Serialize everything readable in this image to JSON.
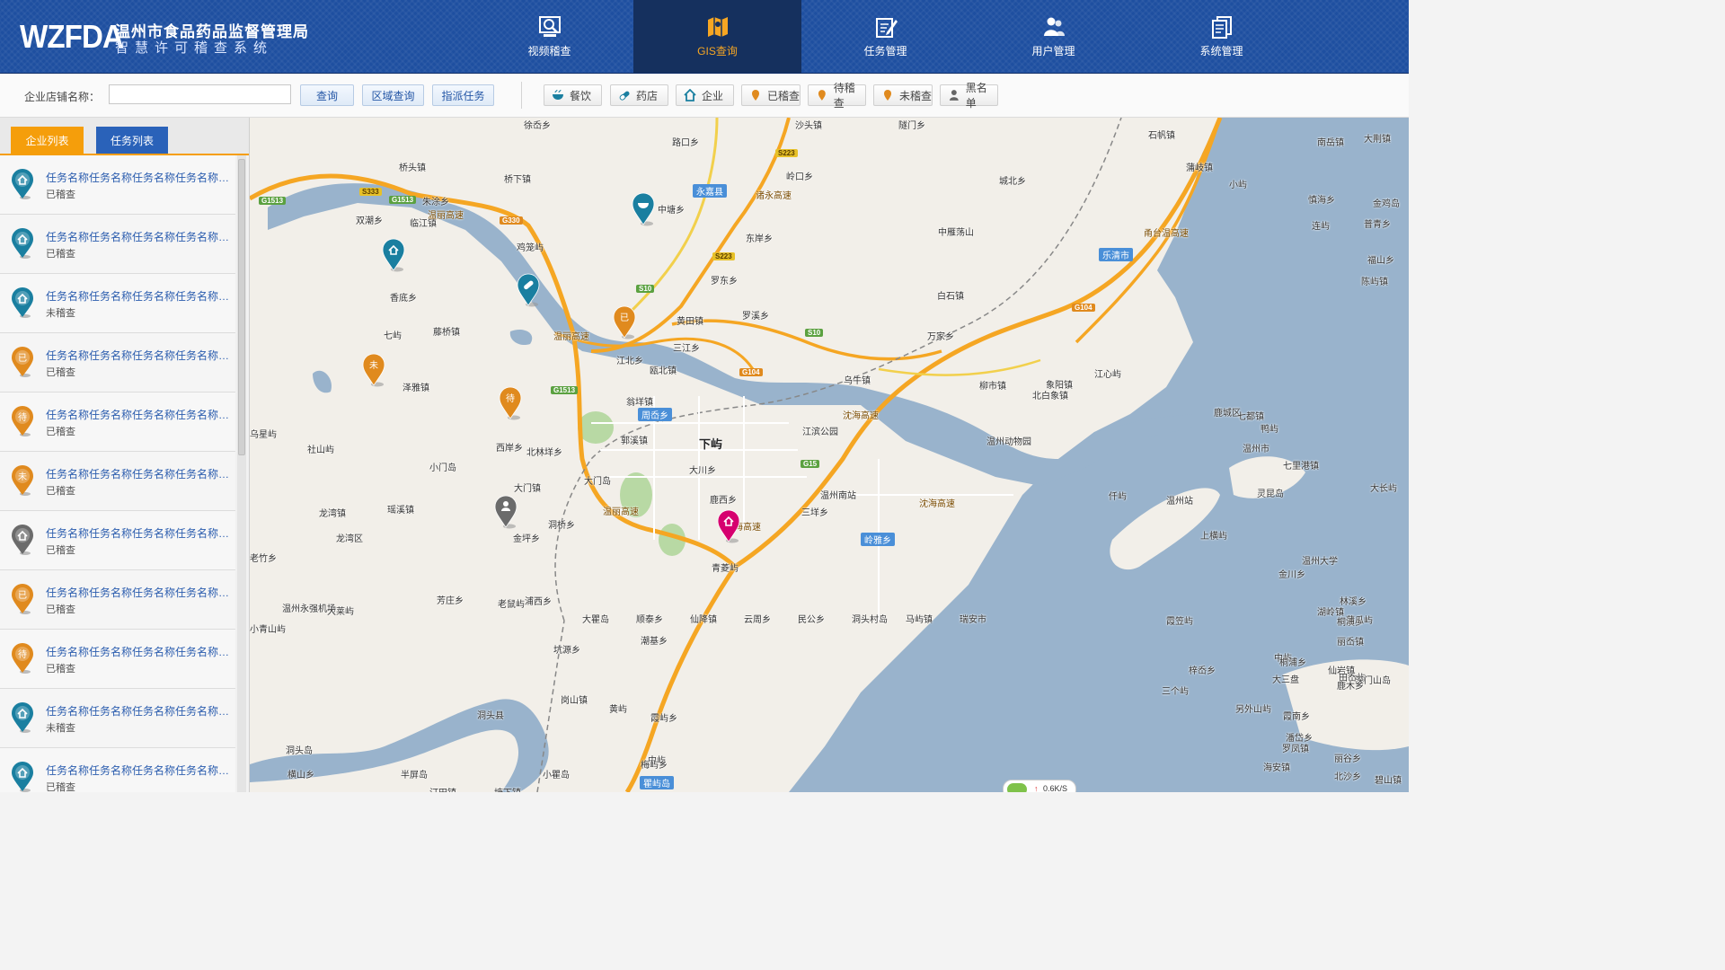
{
  "header": {
    "logo": "WZFDA",
    "title": "温州市食品药品监督管理局",
    "subtitle": "智慧许可稽查系统",
    "nav": [
      {
        "label": "视频稽查",
        "icon": "video-inspect-icon",
        "active": false
      },
      {
        "label": "GIS查询",
        "icon": "gis-map-icon",
        "active": true
      },
      {
        "label": "任务管理",
        "icon": "task-edit-icon",
        "active": false
      },
      {
        "label": "用户管理",
        "icon": "users-icon",
        "active": false
      },
      {
        "label": "系统管理",
        "icon": "documents-icon",
        "active": false
      }
    ]
  },
  "toolbar": {
    "search_label": "企业店铺名称：",
    "search_value": "",
    "query_button": "查询",
    "area_query_button": "区域查询",
    "assign_task_button": "指派任务",
    "filters": [
      {
        "label": "餐饮",
        "icon": "bowl-icon"
      },
      {
        "label": "药店",
        "icon": "pill-icon"
      },
      {
        "label": "企业",
        "icon": "home-icon"
      },
      {
        "label": "已稽查",
        "icon": "pin-orange-icon"
      },
      {
        "label": "待稽查",
        "icon": "pin-orange-icon"
      },
      {
        "label": "未稽查",
        "icon": "pin-orange-icon"
      },
      {
        "label": "黑名单",
        "icon": "person-icon"
      }
    ]
  },
  "panel": {
    "tabs": [
      "企业列表",
      "任务列表"
    ],
    "active_tab": 0,
    "items": [
      {
        "title": "任务名称任务名称任务名称任务名称任务名称",
        "status": "已稽查",
        "pin": "food",
        "color": "#1a7fa0"
      },
      {
        "title": "任务名称任务名称任务名称任务名称任务名称",
        "status": "已稽查",
        "pin": "pharmacy",
        "color": "#1a7fa0"
      },
      {
        "title": "任务名称任务名称任务名称任务名称任务名称",
        "status": "未稽查",
        "pin": "enterprise",
        "color": "#1a7fa0"
      },
      {
        "title": "任务名称任务名称任务名称任务名称任务名称",
        "status": "已稽查",
        "pin": "已",
        "color": "#e08a1e"
      },
      {
        "title": "任务名称任务名称任务名称任务名称任务名称",
        "status": "已稽查",
        "pin": "待",
        "color": "#e08a1e"
      },
      {
        "title": "任务名称任务名称任务名称任务名称任务名称",
        "status": "已稽查",
        "pin": "未",
        "color": "#e08a1e"
      },
      {
        "title": "任务名称任务名称任务名称任务名称任务名称",
        "status": "已稽查",
        "pin": "blacklist",
        "color": "#6b6b6b"
      },
      {
        "title": "任务名称任务名称任务名称任务名称任务名称",
        "status": "已稽查",
        "pin": "已",
        "color": "#e08a1e"
      },
      {
        "title": "任务名称任务名称任务名称任务名称任务名称",
        "status": "已稽查",
        "pin": "待",
        "color": "#e08a1e"
      },
      {
        "title": "任务名称任务名称任务名称任务名称任务名称",
        "status": "未稽查",
        "pin": "enterprise",
        "color": "#1a7fa0"
      },
      {
        "title": "任务名称任务名称任务名称任务名称任务名称",
        "status": "已稽查",
        "pin": "food",
        "color": "#1a7fa0"
      }
    ]
  },
  "map": {
    "labels": [
      "徐岙乡",
      "路口乡",
      "沙头镇",
      "隧门乡",
      "石帆镇",
      "南岳镇",
      "大荆镇",
      "桥头镇",
      "桥下镇",
      "岭口乡",
      "永嘉县",
      "中塘乡",
      "城北乡",
      "蒲岐镇",
      "小屿",
      "慎海乡",
      "金鸡岛",
      "双潮乡",
      "临江镇",
      "朱涂乡",
      "鸡笼屿",
      "东岸乡",
      "中雁荡山",
      "乐清市",
      "连屿",
      "普青乡",
      "福山乡",
      "陈屿镇",
      "香底乡",
      "罗东乡",
      "白石镇",
      "七屿",
      "藤桥镇",
      "黄田镇",
      "罗溪乡",
      "万家乡",
      "江北乡",
      "三江乡",
      "瓯北镇",
      "乌牛镇",
      "柳市镇",
      "象阳镇",
      "泽雅镇",
      "江心屿",
      "北白象镇",
      "翁垟镇",
      "周岙乡",
      "江滨公园",
      "鹿城区",
      "七都镇",
      "鸭屿",
      "乌星屿",
      "社山屿",
      "北林垟乡",
      "西岸乡",
      "郭溪镇",
      "下屿",
      "温州动物园",
      "温州市",
      "七里港镇",
      "小门岛",
      "大门岛",
      "大川乡",
      "仟屿",
      "温州站",
      "灵昆岛",
      "大长屿",
      "大门镇",
      "鹿西乡",
      "温州南站",
      "三垟乡",
      "龙湾镇",
      "瑶溪镇",
      "洞桥乡",
      "金坪乡",
      "岭雅乡",
      "上横屿",
      "老竹乡",
      "龙湾区",
      "青菱屿",
      "金川乡",
      "温州大学",
      "温州永强机场",
      "芳庄乡",
      "林溪乡",
      "小青山屿",
      "大莱屿",
      "湖岭镇",
      "老鼠屿",
      "坑源乡",
      "潮基乡",
      "丽岙镇",
      "桐溪乡",
      "霞笠屿",
      "蒲瓜屿",
      "中屿",
      "梓岙乡",
      "仙岩镇",
      "田岙屿",
      "深门山岛",
      "大三盘",
      "鹿木乡",
      "浦西乡",
      "霞南乡",
      "霞屿乡",
      "三个屿",
      "另外山屿",
      "岗山镇",
      "桐浦乡",
      "潘岱乡",
      "罗凤镇",
      "北沙乡",
      "洞头县",
      "黄屿",
      "中屿",
      "洞头岛",
      "半屏岛",
      "海安镇",
      "碧山镇",
      "横山乡",
      "塘下镇",
      "小瞿岛",
      "梅屿乡",
      "丽谷乡",
      "汀田镇",
      "瞿屿岛",
      "大瞿岛",
      "顺泰乡",
      "仙降镇",
      "云周乡",
      "民公乡",
      "洞头村岛",
      "马屿镇",
      "瑞安市"
    ],
    "road_shields": [
      "G1513",
      "S333",
      "G1513",
      "G330",
      "S223",
      "S223",
      "S10",
      "S10",
      "G104",
      "G104",
      "G1513",
      "G15"
    ],
    "expressway_labels": [
      "温丽高速",
      "诸永高速",
      "温丽高速",
      "沈海高速",
      "沈海高速",
      "温丽高速",
      "沈海高速",
      "甬台温高速"
    ],
    "markers": [
      "food",
      "enterprise",
      "pharmacy",
      "已",
      "未",
      "待",
      "blacklist",
      "enterprise-highlight"
    ],
    "net_speed": "0.6K/S"
  },
  "colors": {
    "header": "#1e4fa0",
    "active_nav": "#15305e",
    "accent_orange": "#f59e0b",
    "tab_blue": "#2a62b9",
    "sea": "#99b3cc",
    "land": "#f2efe9",
    "expressway": "#f5a623",
    "pin_teal": "#1a7fa0",
    "pin_orange": "#e08a1e",
    "pin_gray": "#6b6b6b",
    "pin_magenta": "#d6006f"
  }
}
